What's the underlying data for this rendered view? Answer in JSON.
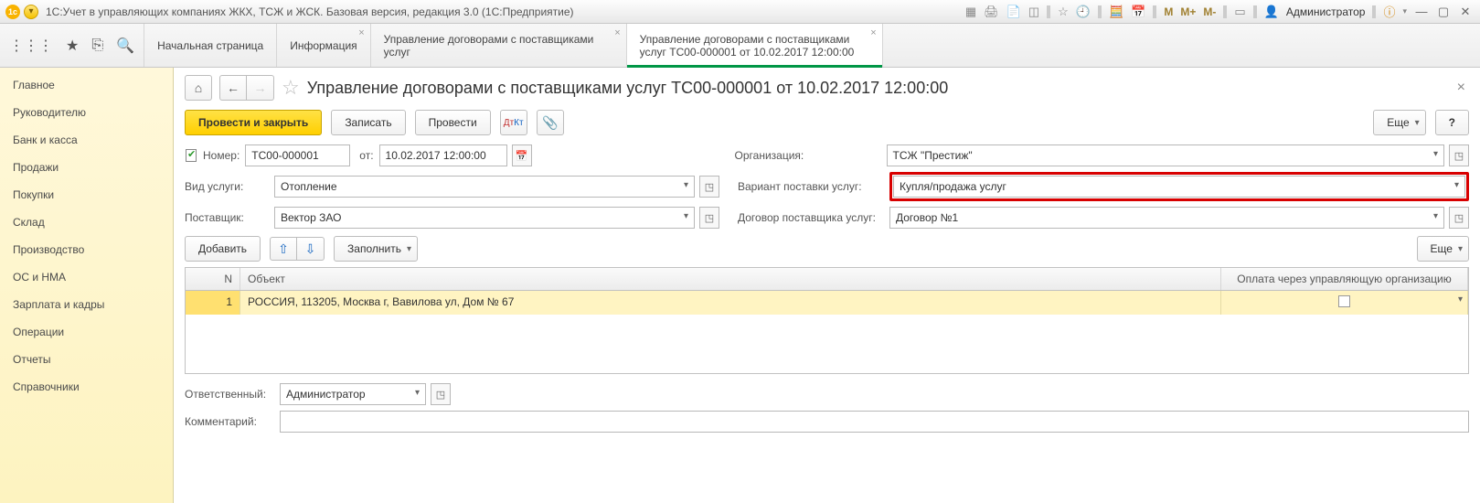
{
  "titlebar": {
    "title": "1С:Учет в управляющих компаниях ЖКХ, ТСЖ и ЖСК. Базовая версия, редакция 3.0  (1С:Предприятие)",
    "user": "Администратор"
  },
  "tabs": [
    {
      "label": "Начальная страница"
    },
    {
      "label": "Информация"
    },
    {
      "label": "Управление договорами с поставщиками услуг"
    },
    {
      "label": "Управление договорами с поставщиками услуг ТС00-000001 от 10.02.2017 12:00:00"
    }
  ],
  "sidebar": {
    "items": [
      "Главное",
      "Руководителю",
      "Банк и касса",
      "Продажи",
      "Покупки",
      "Склад",
      "Производство",
      "ОС и НМА",
      "Зарплата и кадры",
      "Операции",
      "Отчеты",
      "Справочники"
    ]
  },
  "page": {
    "title": "Управление договорами с поставщиками услуг ТС00-000001 от 10.02.2017 12:00:00"
  },
  "actions": {
    "post_close": "Провести и закрыть",
    "write": "Записать",
    "post": "Провести",
    "more": "Еще",
    "help": "?",
    "add": "Добавить",
    "fill": "Заполнить"
  },
  "fields": {
    "number_lbl": "Номер:",
    "number_val": "ТС00-000001",
    "date_lbl": "от:",
    "date_val": "10.02.2017 12:00:00",
    "org_lbl": "Организация:",
    "org_val": "ТСЖ \"Престиж\"",
    "service_lbl": "Вид услуги:",
    "service_val": "Отопление",
    "variant_lbl": "Вариант поставки услуг:",
    "variant_val": "Купля/продажа услуг",
    "supplier_lbl": "Поставщик:",
    "supplier_val": "Вектор ЗАО",
    "contract_lbl": "Договор поставщика услуг:",
    "contract_val": "Договор №1",
    "responsible_lbl": "Ответственный:",
    "responsible_val": "Администратор",
    "comment_lbl": "Комментарий:",
    "comment_val": ""
  },
  "table": {
    "cols": {
      "n": "N",
      "obj": "Объект",
      "pay": "Оплата через управляющую организацию"
    },
    "rows": [
      {
        "n": "1",
        "obj": "РОССИЯ, 113205, Москва г, Вавилова ул, Дом № 67",
        "pay": false
      }
    ]
  }
}
